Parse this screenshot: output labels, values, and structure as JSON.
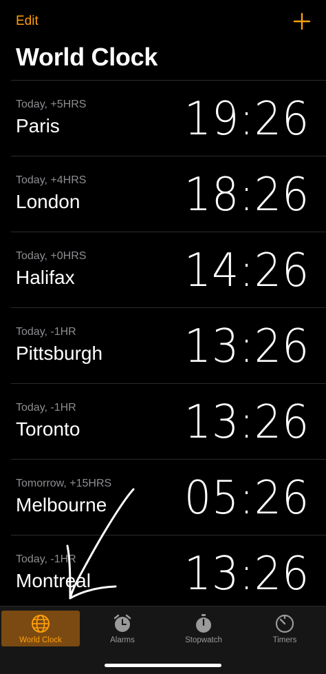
{
  "header": {
    "edit_label": "Edit",
    "add_icon": "plus-icon",
    "title": "World Clock"
  },
  "clocks": [
    {
      "offset": "Today, +5HRS",
      "city": "Paris",
      "time": "19:26"
    },
    {
      "offset": "Today, +4HRS",
      "city": "London",
      "time": "18:26"
    },
    {
      "offset": "Today, +0HRS",
      "city": "Halifax",
      "time": "14:26"
    },
    {
      "offset": "Today, -1HR",
      "city": "Pittsburgh",
      "time": "13:26"
    },
    {
      "offset": "Today, -1HR",
      "city": "Toronto",
      "time": "13:26"
    },
    {
      "offset": "Tomorrow, +15HRS",
      "city": "Melbourne",
      "time": "05:26"
    },
    {
      "offset": "Today, -1HR",
      "city": "Montreal",
      "time": "13:26"
    }
  ],
  "tabs": [
    {
      "label": "World Clock",
      "icon": "globe-icon",
      "active": true
    },
    {
      "label": "Alarms",
      "icon": "alarm-clock-icon",
      "active": false
    },
    {
      "label": "Stopwatch",
      "icon": "stopwatch-icon",
      "active": false
    },
    {
      "label": "Timers",
      "icon": "timer-icon",
      "active": false
    }
  ],
  "colors": {
    "accent": "#ff9f0a",
    "background": "#000000",
    "secondary_text": "#8e8e93",
    "active_tab_bg": "#7a4a12"
  }
}
